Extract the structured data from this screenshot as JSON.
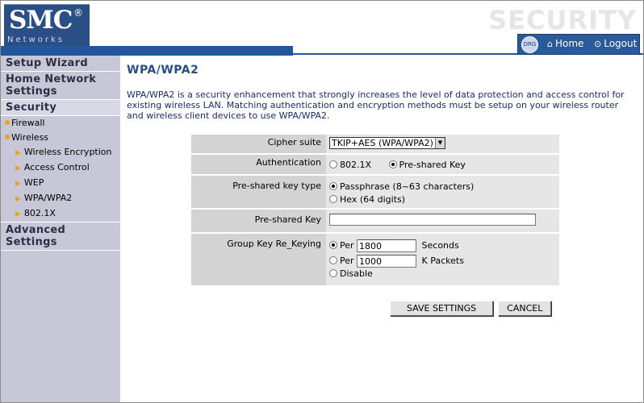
{
  "header": {
    "logo_text": "SMC",
    "logo_reg": "®",
    "logo_sub": "Networks",
    "section_title": "SECURITY",
    "globe_text": "DRG",
    "home_label": "Home",
    "logout_label": "Logout"
  },
  "sidebar": {
    "setup_wizard": "Setup Wizard",
    "home_network": "Home Network Settings",
    "security": "Security",
    "firewall": "Firewall",
    "wireless": "Wireless",
    "wireless_items": [
      "Wireless Encryption",
      "Access Control",
      "WEP",
      "WPA/WPA2",
      "802.1X"
    ],
    "advanced": "Advanced Settings"
  },
  "main": {
    "title": "WPA/WPA2",
    "description": "WPA/WPA2 is a security enhancement that strongly increases the level of data protection and access control for existing wireless LAN. Matching authentication and encryption methods must be setup on your wireless router and wireless client devices to use WPA/WPA2."
  },
  "form": {
    "cipher_label": "Cipher suite",
    "cipher_value": "TKIP+AES (WPA/WPA2)",
    "auth_label": "Authentication",
    "auth_opt1": "802.1X",
    "auth_opt2": "Pre-shared Key",
    "psk_type_label": "Pre-shared key type",
    "psk_type_opt1": "Passphrase (8~63 characters)",
    "psk_type_opt2": "Hex (64 digits)",
    "psk_label": "Pre-shared Key",
    "psk_value": "",
    "rekey_label": "Group Key Re_Keying",
    "rekey_per": "Per",
    "rekey_seconds_value": "1800",
    "rekey_seconds_unit": "Seconds",
    "rekey_packets_value": "1000",
    "rekey_packets_unit": "K Packets",
    "rekey_disable": "Disable"
  },
  "buttons": {
    "save": "SAVE SETTINGS",
    "cancel": "CANCEL"
  }
}
